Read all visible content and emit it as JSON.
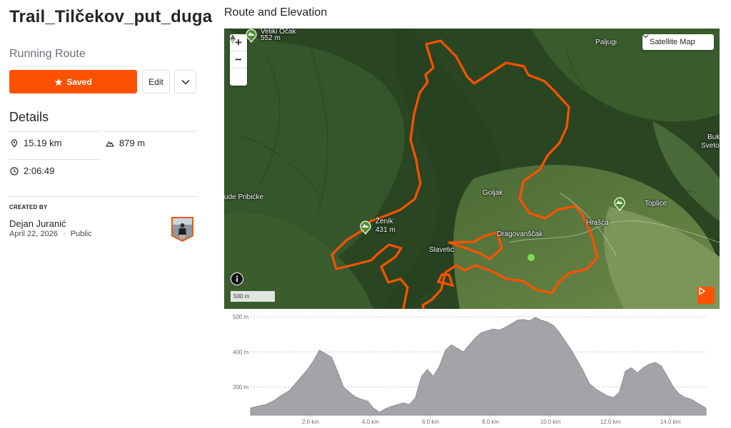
{
  "route": {
    "title": "Trail_Tilčekov_put_duga",
    "type": "Running Route",
    "saved_label": "Saved",
    "edit_label": "Edit"
  },
  "details": {
    "heading": "Details",
    "distance": "15.19 km",
    "elevation_gain": "879 m",
    "duration": "2:06:49"
  },
  "creator": {
    "heading": "CREATED BY",
    "name": "Dejan Juranić",
    "date": "April 22, 2026",
    "separator": "·",
    "visibility": "Public"
  },
  "map": {
    "section_title": "Route and Elevation",
    "map_type": "Satellite Map",
    "scale_label": "500 m",
    "zoom_in": "+",
    "zoom_out": "−",
    "labels": {
      "veliki_ocak": "Veliki Očak",
      "veliki_ocak_elev": "552 m",
      "paljugi": "Paljugi",
      "buk": "Buk",
      "sveto": "Sveto",
      "pribicke": "ude Pribićke",
      "goljak": "Goljak",
      "toplice": "Toplice",
      "zenik": "Ženik",
      "zenik_elev": "431 m",
      "hrasca": "Hrašća",
      "dragovanscak": "Dragovanščak",
      "slavetic": "Slavetić"
    },
    "colors": {
      "route": "#fc5200",
      "start": "#7ed957",
      "accent": "#fc5200"
    }
  },
  "chart_data": {
    "type": "area",
    "x_unit": "km",
    "y_unit": "m",
    "xlim": [
      0,
      15.19
    ],
    "ylim": [
      220,
      500
    ],
    "y_ticks": [
      "500 m",
      "400 m",
      "300 m"
    ],
    "x_ticks": [
      "2.0 km",
      "4.0 km",
      "6.0 km",
      "8.0 km",
      "10.0 km",
      "12.0 km",
      "14.0 km"
    ],
    "x": [
      0,
      0.2,
      0.5,
      0.8,
      1.0,
      1.3,
      1.6,
      1.9,
      2.1,
      2.3,
      2.5,
      2.7,
      2.9,
      3.1,
      3.3,
      3.5,
      3.7,
      3.9,
      4.1,
      4.3,
      4.5,
      4.7,
      4.9,
      5.1,
      5.3,
      5.5,
      5.7,
      5.9,
      6.1,
      6.3,
      6.5,
      6.7,
      6.9,
      7.1,
      7.3,
      7.5,
      7.7,
      7.9,
      8.1,
      8.3,
      8.5,
      8.7,
      8.9,
      9.1,
      9.3,
      9.5,
      9.7,
      9.9,
      10.1,
      10.3,
      10.5,
      10.7,
      10.9,
      11.1,
      11.3,
      11.5,
      11.7,
      11.9,
      12.1,
      12.3,
      12.5,
      12.7,
      12.9,
      13.1,
      13.3,
      13.5,
      13.7,
      13.9,
      14.1,
      14.3,
      14.5,
      14.7,
      14.9,
      15.19
    ],
    "y": [
      240,
      245,
      250,
      262,
      275,
      290,
      320,
      350,
      375,
      405,
      395,
      385,
      345,
      300,
      285,
      272,
      265,
      260,
      240,
      228,
      238,
      245,
      250,
      255,
      250,
      270,
      330,
      350,
      330,
      360,
      405,
      420,
      410,
      400,
      420,
      440,
      455,
      460,
      465,
      462,
      470,
      480,
      490,
      492,
      488,
      498,
      490,
      485,
      475,
      455,
      430,
      405,
      375,
      345,
      310,
      295,
      285,
      275,
      270,
      285,
      345,
      355,
      340,
      355,
      365,
      370,
      360,
      330,
      300,
      280,
      270,
      265,
      255,
      240
    ]
  }
}
